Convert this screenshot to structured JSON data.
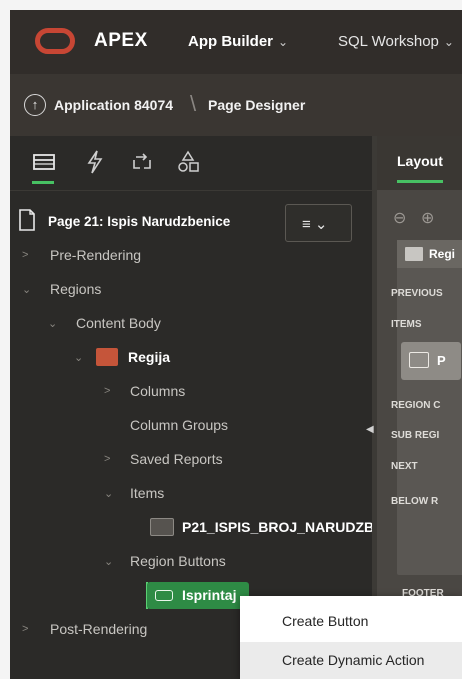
{
  "header": {
    "brand": "APEX",
    "menus": [
      {
        "label": "App Builder"
      },
      {
        "label": "SQL Workshop"
      }
    ]
  },
  "breadcrumb": {
    "application": "Application 84074",
    "current": "Page Designer"
  },
  "left_panel": {
    "tabs": [
      "rendering-icon",
      "dynamic-actions-icon",
      "processing-icon",
      "shared-components-icon"
    ],
    "page_header": "Page 21: Ispis Narudzbenice",
    "tree": [
      {
        "label": "Pre-Rendering"
      },
      {
        "label": "Regions"
      },
      {
        "label": "Content Body"
      },
      {
        "label": "Regija"
      },
      {
        "label": "Columns"
      },
      {
        "label": "Column Groups"
      },
      {
        "label": "Saved Reports"
      },
      {
        "label": "Items"
      },
      {
        "label": "P21_ISPIS_BROJ_NARUDZB"
      },
      {
        "label": "Region Buttons"
      },
      {
        "label": "Isprintaj"
      },
      {
        "label": "Post-Rendering"
      }
    ]
  },
  "right_panel": {
    "tab": "Layout",
    "region_title": "Regi",
    "labels": [
      "PREVIOUS",
      "ITEMS",
      "REGION C",
      "SUB REGI",
      "NEXT",
      "BELOW R"
    ],
    "item_label": "P",
    "footer": "FOOTER"
  },
  "context_menu": {
    "items": [
      {
        "label": "Create Button"
      },
      {
        "label": "Create Dynamic Action"
      }
    ]
  },
  "colors": {
    "brand_red": "#c74634",
    "accent_green": "#47c163",
    "selected_green": "#2e8b45"
  }
}
